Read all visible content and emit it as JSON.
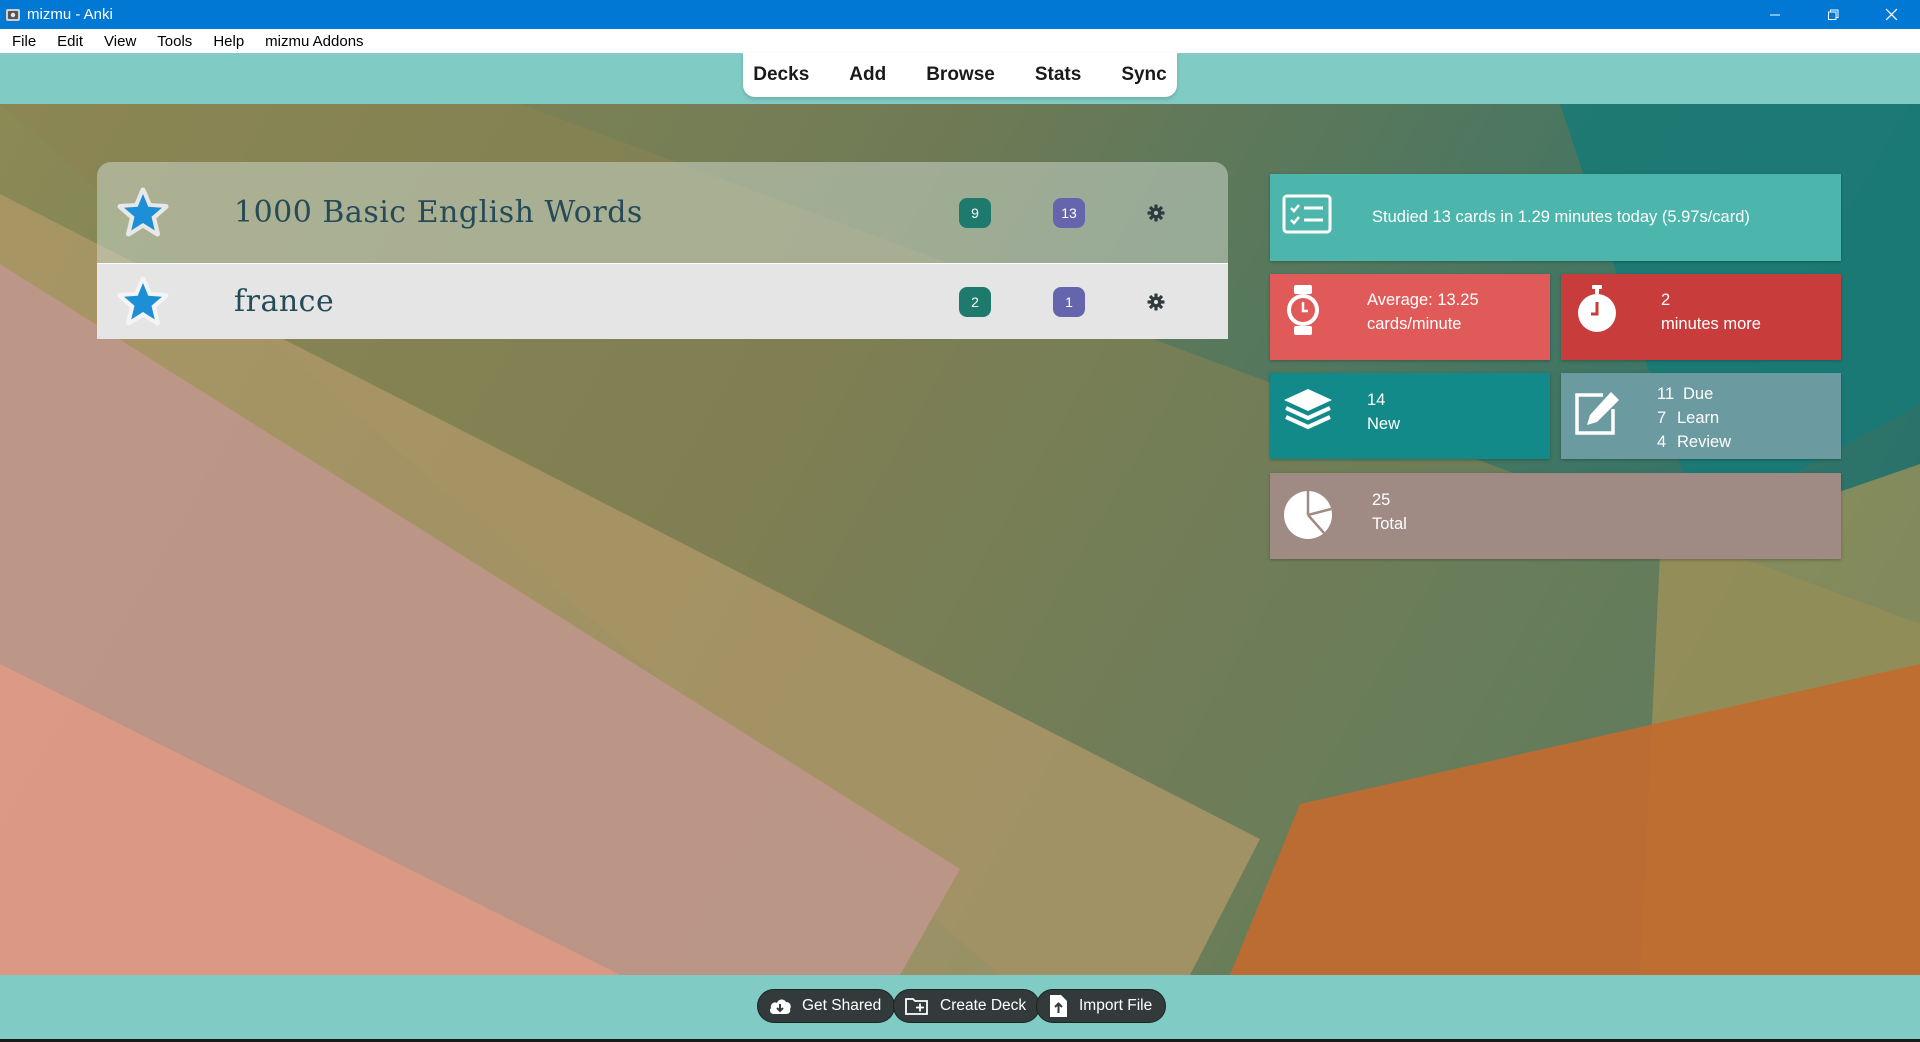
{
  "window": {
    "title": "mizmu - Anki",
    "icon": "anki-icon",
    "controls": [
      "minimize-icon",
      "restore-icon",
      "close-icon"
    ]
  },
  "menubar": {
    "items": [
      "File",
      "Edit",
      "View",
      "Tools",
      "Help",
      "mizmu Addons"
    ]
  },
  "toolbar": {
    "links": [
      "Decks",
      "Add",
      "Browse",
      "Stats",
      "Sync"
    ]
  },
  "decks": [
    {
      "name": "1000 Basic English Words",
      "new_count": "9",
      "due_count": "13",
      "icon": "star-icon",
      "options_icon": "gear-icon"
    },
    {
      "name": "france",
      "new_count": "2",
      "due_count": "1",
      "icon": "star-icon",
      "options_icon": "gear-icon"
    }
  ],
  "stats": {
    "studied": {
      "text": "Studied 13 cards in 1.29 minutes today (5.97s/card)",
      "icon": "checklist-icon",
      "color": "#4db6ac"
    },
    "average": {
      "line1": "Average: 13.25",
      "line2": "cards/minute",
      "icon": "watch-icon",
      "color": "#e05a5a"
    },
    "remaining": {
      "line1": "2",
      "line2": "minutes more",
      "icon": "stopwatch-icon",
      "color": "#c93c3c"
    },
    "new": {
      "line1": "14",
      "line2": "New",
      "icon": "layers-icon",
      "color": "#138a8a"
    },
    "review": {
      "icon": "edit-icon",
      "color": "#6b9aa0",
      "rows": [
        {
          "count": "11",
          "label": "Due"
        },
        {
          "count": "7",
          "label": "Learn"
        },
        {
          "count": "4",
          "label": "Review"
        }
      ]
    },
    "total": {
      "line1": "25",
      "line2": "Total",
      "icon": "pie-chart-icon",
      "color": "#a08a84"
    }
  },
  "bottom_buttons": [
    {
      "label": "Get Shared",
      "icon": "cloud-download-icon"
    },
    {
      "label": "Create Deck",
      "icon": "folder-add-icon"
    },
    {
      "label": "Import File",
      "icon": "file-upload-icon"
    }
  ],
  "colors": {
    "titlebar": "#0078d4",
    "toolbar": "#80cbc4",
    "badge_new": "#1f7a6e",
    "badge_due": "#6565ad"
  }
}
